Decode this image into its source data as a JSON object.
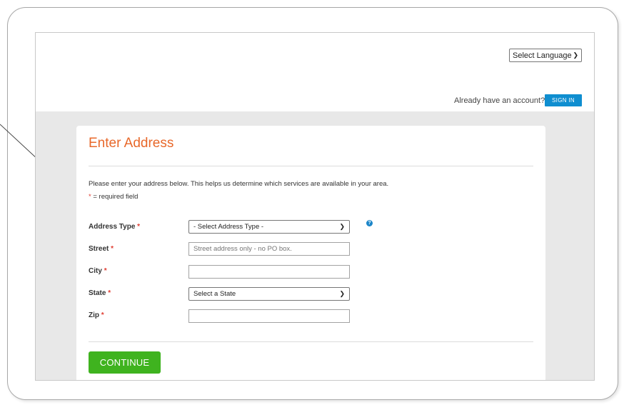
{
  "header": {
    "language_select": {
      "value": "Select Language"
    },
    "account_prompt": "Already have an account?",
    "sign_in_label": "SIGN IN"
  },
  "form": {
    "title": "Enter Address",
    "intro": "Please enter your address below. This helps us determine which services are available in your area.",
    "required_star": "*",
    "required_note": " = required field",
    "fields": [
      {
        "label": "Address Type",
        "type": "select",
        "value": "- Select Address Type -"
      },
      {
        "label": "Street",
        "type": "text",
        "value": "",
        "placeholder": "Street address only - no PO box."
      },
      {
        "label": "City",
        "type": "text",
        "value": ""
      },
      {
        "label": "State",
        "type": "select",
        "value": "Select a State"
      },
      {
        "label": "Zip",
        "type": "text",
        "value": ""
      }
    ],
    "continue_label": "CONTINUE"
  },
  "colors": {
    "title_orange": "#e8682a",
    "sign_in_blue": "#0f8ed0",
    "continue_green": "#3fb31f",
    "required_red": "#e03c31"
  },
  "icons": {
    "help": "help-circle-icon",
    "dropdown": "chevron-down-icon"
  }
}
